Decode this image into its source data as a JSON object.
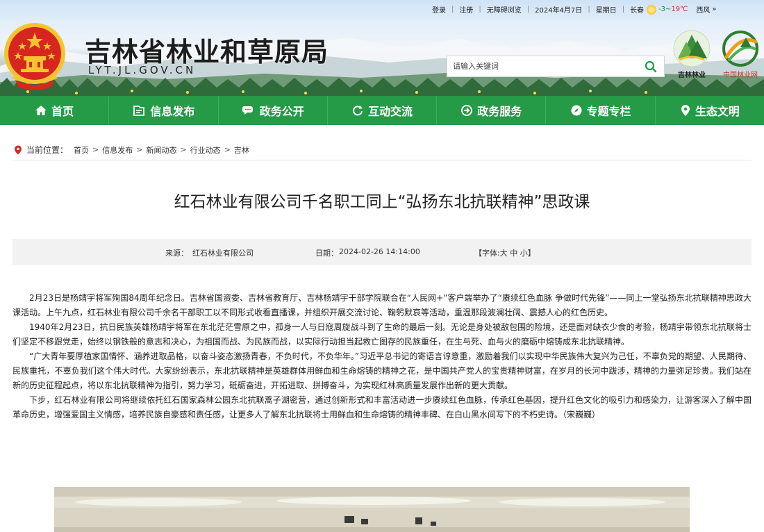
{
  "topbar": {
    "login": "登录",
    "register": "注册",
    "accessible": "无障碍浏览",
    "date": "2024年4月7日",
    "weekday": "星期日",
    "city": "长春",
    "temp_low": "-3",
    "temp_sep": "~",
    "temp_high": "19℃",
    "wind": "西风",
    "more": "»"
  },
  "header": {
    "site_title": "吉林省林业和草原局",
    "site_domain": "LYT.JL.GOV.CN",
    "logo1_caption": "吉林林业",
    "logo2_caption": "中国林业网"
  },
  "search": {
    "placeholder": "请输入关键词"
  },
  "nav": [
    {
      "label": "首页",
      "icon": "home-icon"
    },
    {
      "label": "信息发布",
      "icon": "document-icon"
    },
    {
      "label": "政务公开",
      "icon": "chat-icon"
    },
    {
      "label": "互动交流",
      "icon": "refresh-icon"
    },
    {
      "label": "政务服务",
      "icon": "service-icon"
    },
    {
      "label": "专题专栏",
      "icon": "compass-icon"
    },
    {
      "label": "生态文明",
      "icon": "pin-icon"
    }
  ],
  "breadcrumb": {
    "label": "当前位置：",
    "items": [
      "首页",
      "信息发布",
      "新闻动态",
      "行业动态",
      "吉林"
    ]
  },
  "article": {
    "title": "红石林业有限公司千名职工同上“弘扬东北抗联精神”思政课",
    "source_label": "来源：",
    "source": "红石林业有限公司",
    "date_label": "日期：",
    "date": "2024-02-26 14:14:00",
    "font_size": "【字体:大 中 小】",
    "paragraphs": [
      "2月23日是杨靖宇将军殉国84周年纪念日。吉林省国资委、吉林省教育厅、吉林杨靖宇干部学院联合在“人民网+”客户端举办了“赓续红色血脉 争做时代先锋”——同上一堂弘扬东北抗联精神思政大课活动。上午九点，红石林业有限公司千余名干部职工以不同形式收看直播课，并组织开展交流讨论、鞠躬默哀等活动，重温那段波澜壮阔、震撼人心的红色历史。",
      "1940年2月23日，抗日民族英雄杨靖宇将军在东北茫茫雪原之中，孤身一人与日寇周旋战斗到了生命的最后一刻。无论是身处被敌包围的险境，还是面对缺衣少食的考验，杨靖宇带领东北抗联将士们坚定不移跟党走，始终以钢铁般的意志和决心，为祖国而战、为民族而战，以实际行动担当起救亡图存的民族重任，在生与死、血与火的磨砺中熔铸成东北抗联精神。",
      "“广大青年要厚植家国情怀、涵养进取品格，以奋斗姿态激扬青春，不负时代，不负华年。”习近平总书记的寄语言谆意重，激励着我们以实现中华民族伟大复兴为己任，不辜负党的期望、人民期待、民族重托，不辜负我们这个伟大时代。大家纷纷表示，东北抗联精神是英雄群体用鲜血和生命熔铸的精神之花，是中国共产党人的宝贵精神财富，在岁月的长河中跋涉，精神的力量弥足珍贵。我们站在新的历史征程起点，将以东北抗联精神为指引，努力学习，砥砺奋进，开拓进取、拼搏奋斗，为实现红林高质量发展作出新的更大贡献。",
      "下步，红石林业有限公司将继续依托红石国家森林公园东北抗联蒿子湖密营，通过创新形式和丰富活动进一步赓续红色血脉，传承红色基因，提升红色文化的吸引力和感染力，让游客深入了解中国革命历史，增强爱国主义情感，培养民族自豪感和责任感，让更多人了解东北抗联将士用鲜血和生命熔铸的精神丰碑、在白山黑水间写下的不朽史诗。（宋巍巍）"
    ]
  },
  "colors": {
    "nav_green": "#259a47",
    "emblem_red": "#d7261f",
    "emblem_gold": "#f4c430"
  }
}
